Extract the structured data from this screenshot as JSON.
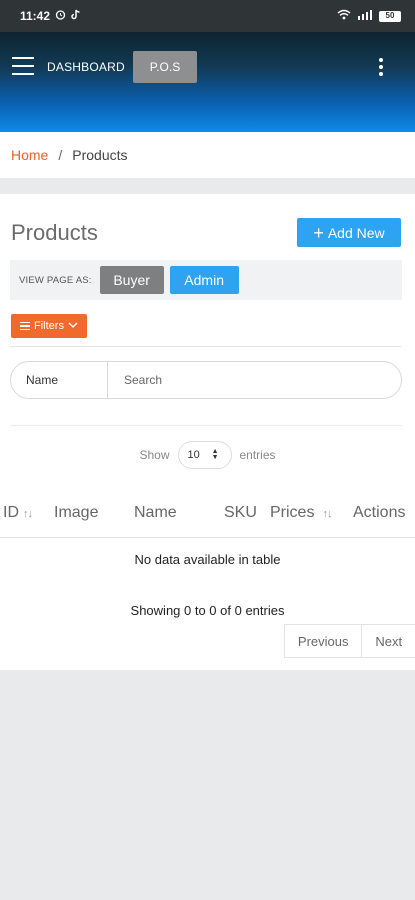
{
  "status_bar": {
    "time": "11:42",
    "battery": "50"
  },
  "header": {
    "dashboard_label": "DASHBOARD",
    "pos_label": "P.O.S"
  },
  "breadcrumb": {
    "home": "Home",
    "separator": "/",
    "current": "Products"
  },
  "page": {
    "title": "Products",
    "add_new_label": "Add New",
    "view_as_label": "VIEW PAGE AS:",
    "buyer_label": "Buyer",
    "admin_label": "Admin",
    "filters_label": "Filters"
  },
  "search": {
    "field_label": "Name",
    "placeholder": "Search"
  },
  "length": {
    "show_label": "Show",
    "value": "10",
    "entries_label": "entries"
  },
  "table": {
    "columns": [
      "ID",
      "Image",
      "Name",
      "SKU",
      "Prices",
      "Actions"
    ],
    "empty_message": "No data available in table",
    "info": "Showing 0 to 0 of 0 entries"
  },
  "pagination": {
    "previous_label": "Previous",
    "next_label": "Next"
  },
  "colors": {
    "accent_blue": "#2ea3f2",
    "accent_orange": "#ef6a2c",
    "breadcrumb_home": "#e8632b"
  }
}
